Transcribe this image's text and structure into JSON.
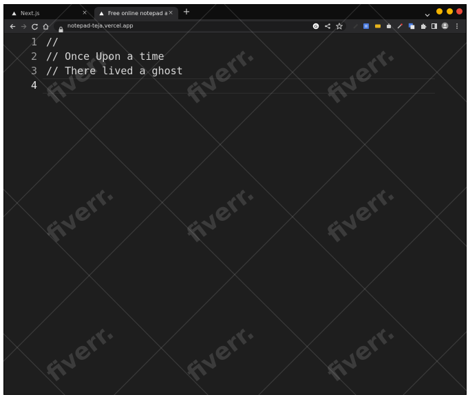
{
  "browser": {
    "tabs": [
      {
        "label": "Next.js",
        "active": false
      },
      {
        "label": "Free online notepad app",
        "active": true
      }
    ],
    "new_tab_symbol": "+",
    "tab_close_symbol": "×",
    "url": "notepad-teja.vercel.app",
    "icons": {
      "back": "arrow-left-icon",
      "forward": "arrow-right-icon",
      "reload": "reload-icon",
      "home": "home-icon",
      "lock": "lock-icon",
      "google": "google-icon",
      "share": "share-icon",
      "bookmark": "star-icon",
      "extensions": "puzzle-icon",
      "menu": "kebab-menu-icon"
    },
    "window_button_colors": {
      "minimize": "#f4b400",
      "maximize": "#f4b400",
      "close": "#e84a3b"
    }
  },
  "editor": {
    "lines": [
      {
        "number": "1",
        "text": "//"
      },
      {
        "number": "2",
        "text": "// Once Upon a time"
      },
      {
        "number": "3",
        "text": "// There lived a ghost"
      },
      {
        "number": "4",
        "text": ""
      }
    ],
    "active_line": "4"
  },
  "watermark": {
    "text": "fiverr."
  }
}
